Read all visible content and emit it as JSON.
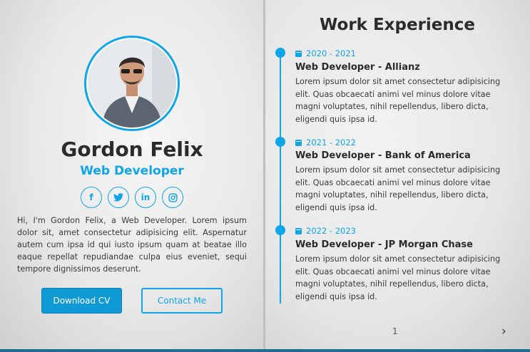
{
  "profile": {
    "name": "Gordon Felix",
    "role": "Web Developer",
    "socials": [
      {
        "icon": "facebook-icon",
        "glyph": "f"
      },
      {
        "icon": "twitter-icon",
        "glyph": "t"
      },
      {
        "icon": "linkedin-icon",
        "glyph": "in"
      },
      {
        "icon": "instagram-icon",
        "glyph": "◎"
      }
    ],
    "bio": "Hi, I'm Gordon Felix, a Web Developer. Lorem ipsum dolor sit, amet consectetur adipisicing elit. Aspernatur autem cum ipsa id qui iusto ipsum quam at beatae illo eaque repellat repudiandae culpa eius eveniet, sequi tempore dignissimos deserunt.",
    "download_label": "Download CV",
    "contact_label": "Contact Me"
  },
  "experience": {
    "title": "Work Experience",
    "items": [
      {
        "period": "2020 - 2021",
        "title": "Web Developer - Allianz",
        "desc": "Lorem ipsum dolor sit amet consectetur adipisicing elit. Quas obcaecati animi vel minus dolore vitae magni voluptates, nihil repellendus, libero dicta, eligendi quis ipsa id."
      },
      {
        "period": "2021 - 2022",
        "title": "Web Developer - Bank of America",
        "desc": "Lorem ipsum dolor sit amet consectetur adipisicing elit. Quas obcaecati animi vel minus dolore vitae magni voluptates, nihil repellendus, libero dicta, eligendi quis ipsa id."
      },
      {
        "period": "2022 - 2023",
        "title": "Web Developer - JP Morgan Chase",
        "desc": "Lorem ipsum dolor sit amet consectetur adipisicing elit. Quas obcaecati animi vel minus dolore vitae magni voluptates, nihil repellendus, libero dicta, eligendi quis ipsa id."
      }
    ]
  },
  "pagination": {
    "page_number": "1",
    "next_glyph": "›"
  },
  "colors": {
    "accent": "#0ea5e9",
    "heading": "#2b2b2b",
    "body_text": "#3a3a3a",
    "frame": "#1d6d8c"
  }
}
